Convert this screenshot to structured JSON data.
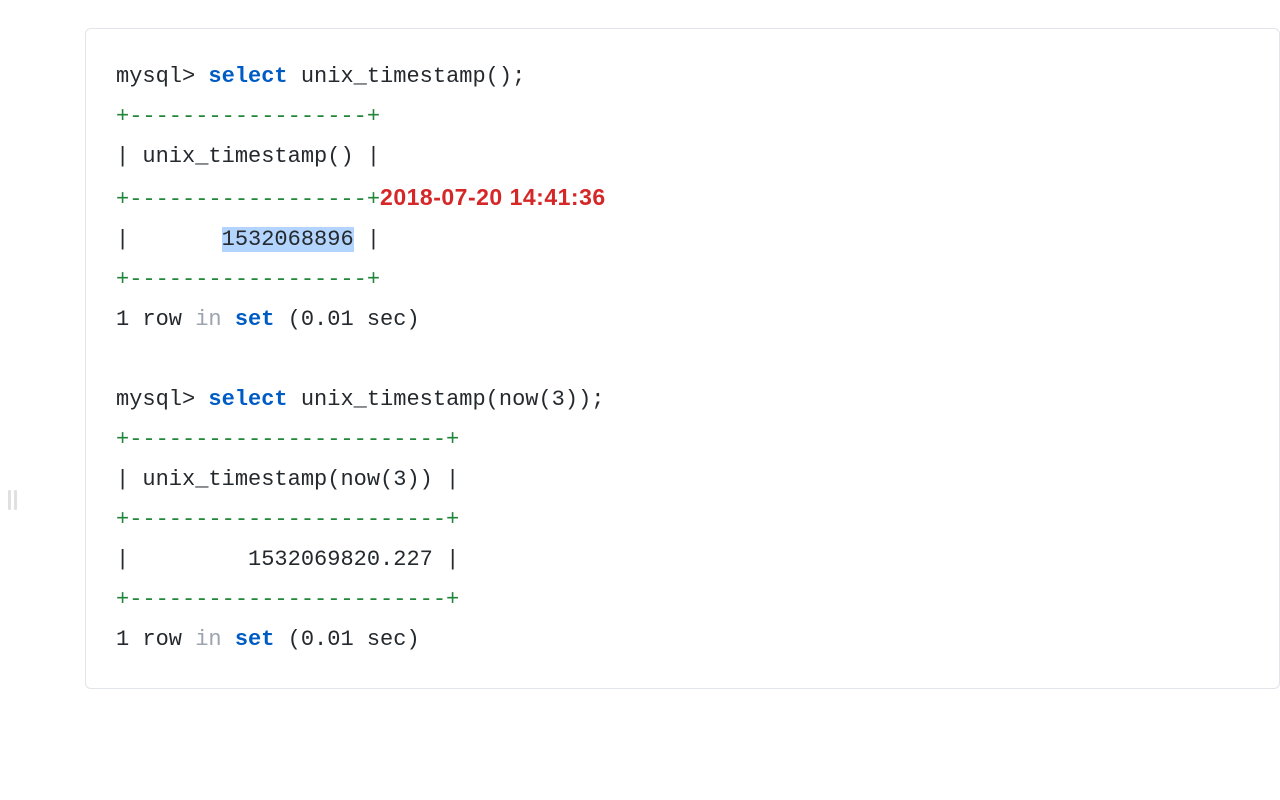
{
  "query1": {
    "prompt": "mysql> ",
    "select": "select",
    "func": " unix_timestamp();",
    "border1": "+------------------+",
    "header_pipe_l": "| ",
    "header_text": "unix_timestamp()",
    "header_pipe_r": " |",
    "border2": "+------------------+",
    "annotation": "2018-07-20 14:41:36",
    "data_pipe_l": "|       ",
    "data_value": "1532068896",
    "data_pipe_r": " |",
    "border3": "+------------------+",
    "footer_row": "1 row ",
    "footer_in": "in",
    "footer_sp": " ",
    "footer_set": "set",
    "footer_time": " (0.01 sec)"
  },
  "query2": {
    "prompt": "mysql> ",
    "select": "select",
    "func": " unix_timestamp(now(3));",
    "border1": "+------------------------+",
    "header_pipe_l": "| ",
    "header_text": "unix_timestamp(now(3))",
    "header_pipe_r": " |",
    "border2": "+------------------------+",
    "data_pipe_l": "|         ",
    "data_value": "1532069820.227",
    "data_pipe_r": " |",
    "border3": "+------------------------+",
    "footer_row": "1 row ",
    "footer_in": "in",
    "footer_sp": " ",
    "footer_set": "set",
    "footer_time": " (0.01 sec)"
  }
}
